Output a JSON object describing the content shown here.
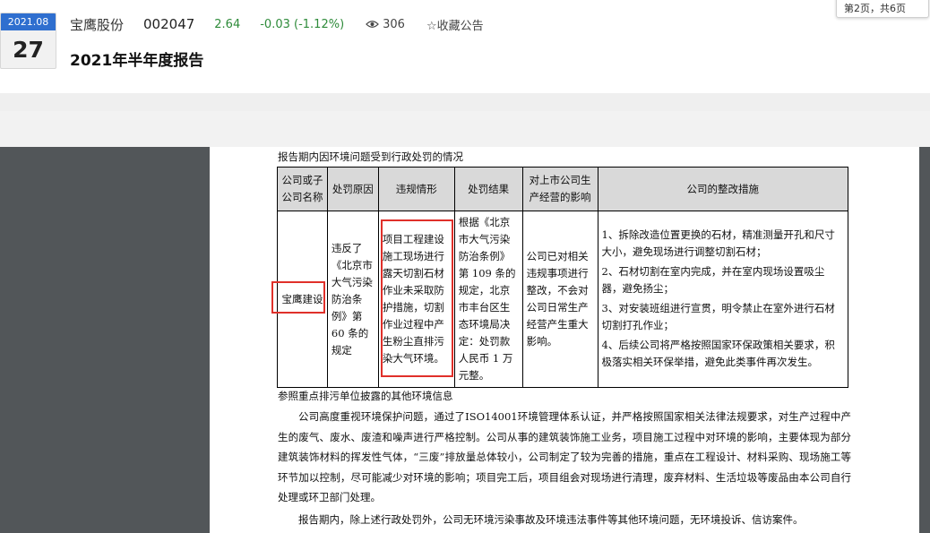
{
  "header": {
    "date_month": "2021.08",
    "date_day": "27",
    "stock_name": "宝鹰股份",
    "stock_code": "002047",
    "price": "2.64",
    "change": "-0.03 (-1.12%)",
    "views": "306",
    "favorite_label": "☆收藏公告",
    "report_title": "2021年半年度报告",
    "page_indicator": "第2页，共6页",
    "accent_color": "#2f6fcf",
    "change_color": "#2e8b3a"
  },
  "document": {
    "section_title": "报告期内因环境问题受到行政处罚的情况",
    "table": {
      "headers": [
        "公司或子公司名称",
        "处罚原因",
        "违规情形",
        "处罚结果",
        "对上市公司生产经营的影响",
        "公司的整改措施"
      ],
      "row": {
        "company": "宝鹰建设",
        "reason": "违反了《北京市大气污染防治条例》第 60 条的规定",
        "violation": "项目工程建设施工现场进行露天切割石材作业未采取防护措施，切割作业过程中产生粉尘直排污染大气环境。",
        "result": "根据《北京市大气污染防治条例》第 109 条的规定，北京市丰台区生态环境局决定：处罚款人民币 1 万元整。",
        "impact": "公司已对相关违规事项进行整改，不会对公司日常生产经营产生重大影响。",
        "measures": [
          "1、拆除改造位置更换的石材，精准测量开孔和尺寸大小，避免现场进行调整切割石材；",
          "2、石材切割在室内完成，并在室内现场设置吸尘器，避免扬尘；",
          "3、对安装班组进行宣贯，明令禁止在室外进行石材切割打孔作业；",
          "4、后续公司将严格按照国家环保政策相关要求，积极落实相关环保举措，避免此类事件再次发生。"
        ]
      }
    },
    "sub_title": "参照重点排污单位披露的其他环境信息",
    "paragraph1": "公司高度重视环境保护问题，通过了ISO14001环境管理体系认证，并严格按照国家相关法律法规要求，对生产过程中产生的废气、废水、废渣和噪声进行严格控制。公司从事的建筑装饰施工业务，项目施工过程中对环境的影响，主要体现为部分建筑装饰材料的挥发性气体，“三废”排放量总体较小，公司制定了较为完善的措施，重点在工程设计、材料采购、现场施工等环节加以控制，尽可能减少对环境的影响；项目完工后，项目组会对现场进行清理，废弃材料、生活垃圾等废品由本公司自行处理或环卫部门处理。",
    "paragraph2": "报告期内，除上述行政处罚外，公司无环境污染事故及环境违法事件等其他环境问题，无环境投诉、信访案件。",
    "highlight_color": "#e0302a"
  }
}
